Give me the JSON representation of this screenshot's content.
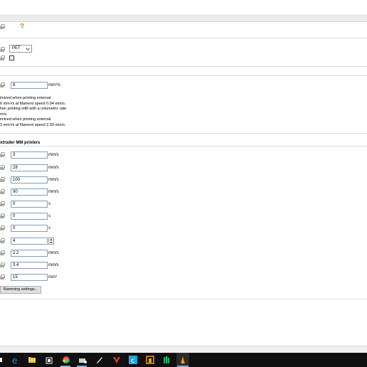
{
  "filament": {
    "type_value": "PET",
    "soluble_checked": false
  },
  "max_volumetric_speed": {
    "value": "8",
    "unit_base": "mm",
    "unit_sup": "3",
    "unit_tail": "/s"
  },
  "note_lines": [
    "imized when printing external",
    "6 mm",
    "/s at filament speed 0.94 mm/s.",
    "hen printing infill with a volumetric rate",
    "m/s.",
    "imized when printing external",
    "3 mm",
    "/s at filament speed 2.09 mm/s."
  ],
  "section": {
    "title": "xtruder MM printers"
  },
  "toolchange_fields": [
    {
      "value": "3",
      "unit": "mm/s"
    },
    {
      "value": "28",
      "unit": "mm/s"
    },
    {
      "value": "100",
      "unit": "mm/s"
    },
    {
      "value": "90",
      "unit": "mm/s"
    },
    {
      "value": "0",
      "unit": "s"
    },
    {
      "value": "0",
      "unit": "s"
    },
    {
      "value": "0",
      "unit": "s"
    },
    {
      "value": "4",
      "unit": ""
    },
    {
      "value": "2.2",
      "unit": "mm/s"
    },
    {
      "value": "3.4",
      "unit": "mm/s"
    },
    {
      "value": "15",
      "unit_base": "mm",
      "unit_sup": "3"
    }
  ],
  "ramming_button_label": "Ramming settings...",
  "help_icon_glyph": "?",
  "colors": {
    "help_icon": "#e07a1a",
    "field_border": "#7f9db9",
    "taskbar": "#101010"
  },
  "taskbar_icons": [
    {
      "name": "start-icon",
      "color": "#ffffff"
    },
    {
      "name": "edge-icon",
      "color": "#1e88e5"
    },
    {
      "name": "file-explorer-icon",
      "color": "#f2c94c"
    },
    {
      "name": "store-icon",
      "color": "#ffffff"
    },
    {
      "name": "chrome-icon",
      "color": "#34a853"
    },
    {
      "name": "cloud-app-icon",
      "color": "#cfcfcf"
    },
    {
      "name": "pen-tool-icon",
      "color": "#dcdcdc"
    },
    {
      "name": "red-v-app-icon",
      "color": "#e53935"
    },
    {
      "name": "c-app-icon",
      "color": "#1ea7e1"
    },
    {
      "name": "orange-app-icon",
      "color": "#f39c12"
    },
    {
      "name": "green-bars-app-icon",
      "color": "#27ae60"
    },
    {
      "name": "prusa-slicer-icon",
      "color": "#f57c00"
    }
  ]
}
